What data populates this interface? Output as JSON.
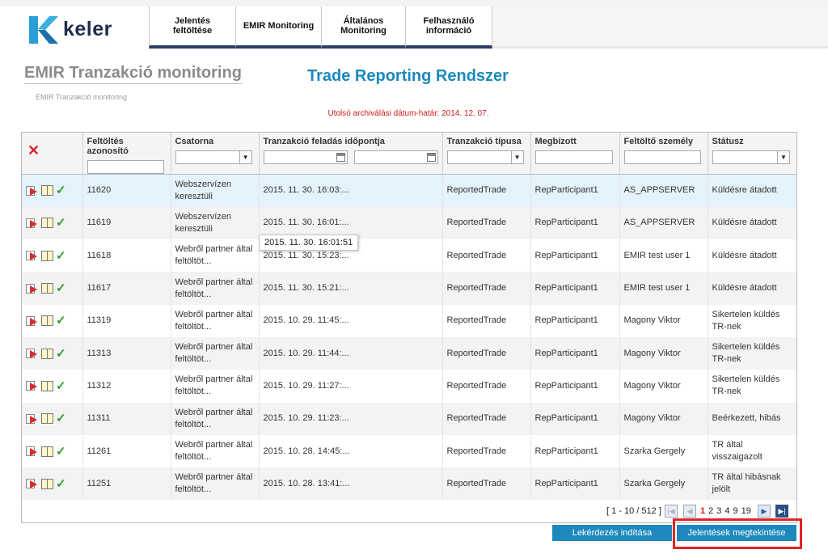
{
  "header": {
    "logo_text": "keler",
    "nav": [
      {
        "label": "Jelentés feltöltése"
      },
      {
        "label": "EMIR Monitoring"
      },
      {
        "label": "Általános Monitoring"
      },
      {
        "label": "Felhasználó információ"
      }
    ]
  },
  "page": {
    "title": "EMIR Tranzakció monitoring",
    "system_title": "Trade Reporting Rendszer",
    "breadcrumb": "EMIR Tranzakció monitoring",
    "archive_label": "Utolsó archiválási dátum-határ:",
    "archive_date": "2014. 12. 07."
  },
  "table": {
    "columns": [
      {
        "label": ""
      },
      {
        "label": "Feltöltés azonosító"
      },
      {
        "label": "Csatorna"
      },
      {
        "label": "Tranzakció feladás időpontja"
      },
      {
        "label": "Tranzakció típusa"
      },
      {
        "label": "Megbízott"
      },
      {
        "label": "Feltöltő személy"
      },
      {
        "label": "Státusz"
      }
    ],
    "rows": [
      {
        "id": "11620",
        "channel": "Webszervízen keresztüli",
        "time": "2015. 11. 30. 16:03:...",
        "type": "ReportedTrade",
        "agent": "RepParticipant1",
        "uploader": "AS_APPSERVER",
        "status": "Küldésre átadott"
      },
      {
        "id": "11619",
        "channel": "Webszervízen keresztüli",
        "time": "2015. 11. 30. 16:01:...",
        "type": "ReportedTrade",
        "agent": "RepParticipant1",
        "uploader": "AS_APPSERVER",
        "status": "Küldésre átadott"
      },
      {
        "id": "11618",
        "channel": "Webről partner által feltöltöt...",
        "time": "2015. 11. 30. 15:23:...",
        "type": "ReportedTrade",
        "agent": "RepParticipant1",
        "uploader": "EMIR test user 1",
        "status": "Küldésre átadott"
      },
      {
        "id": "11617",
        "channel": "Webről partner által feltöltöt...",
        "time": "2015. 11. 30. 15:21:...",
        "type": "ReportedTrade",
        "agent": "RepParticipant1",
        "uploader": "EMIR test user 1",
        "status": "Küldésre átadott"
      },
      {
        "id": "11319",
        "channel": "Webről partner által feltöltöt...",
        "time": "2015. 10. 29. 11:45:...",
        "type": "ReportedTrade",
        "agent": "RepParticipant1",
        "uploader": "Magony Viktor",
        "status": "Sikertelen küldés TR-nek"
      },
      {
        "id": "11313",
        "channel": "Webről partner által feltöltöt...",
        "time": "2015. 10. 29. 11:44:...",
        "type": "ReportedTrade",
        "agent": "RepParticipant1",
        "uploader": "Magony Viktor",
        "status": "Sikertelen küldés TR-nek"
      },
      {
        "id": "11312",
        "channel": "Webről partner által feltöltöt...",
        "time": "2015. 10. 29. 11:27:...",
        "type": "ReportedTrade",
        "agent": "RepParticipant1",
        "uploader": "Magony Viktor",
        "status": "Sikertelen küldés TR-nek"
      },
      {
        "id": "11311",
        "channel": "Webről partner által feltöltöt...",
        "time": "2015. 10. 29. 11:23:...",
        "type": "ReportedTrade",
        "agent": "RepParticipant1",
        "uploader": "Magony Viktor",
        "status": "Beérkezett, hibás"
      },
      {
        "id": "11261",
        "channel": "Webről partner által feltöltöt...",
        "time": "2015. 10. 28. 14:45:...",
        "type": "ReportedTrade",
        "agent": "RepParticipant1",
        "uploader": "Szarka Gergely",
        "status": "TR által visszaigazolt"
      },
      {
        "id": "11251",
        "channel": "Webről partner által feltöltöt...",
        "time": "2015. 10. 28. 13:41:...",
        "type": "ReportedTrade",
        "agent": "RepParticipant1",
        "uploader": "Szarka Gergely",
        "status": "TR által hibásnak jelölt"
      }
    ],
    "tooltip": "2015. 11. 30. 16:01:51"
  },
  "pager": {
    "range": "[ 1 - 10 / 512 ]",
    "pages": [
      "1",
      "2",
      "3",
      "4",
      "9",
      "19"
    ],
    "current": "1",
    "first_glyph": "|◀",
    "prev_glyph": "◀",
    "next_glyph": "▶",
    "last_glyph": "▶|"
  },
  "buttons": {
    "query": "Lekérdezés indítása",
    "reports": "Jelentések megtekintése"
  },
  "icons": {
    "clear_filters": "clear-filters-icon",
    "send": "send-icon",
    "view": "book-icon",
    "approve": "check-icon"
  },
  "colors": {
    "accent_blue": "#1c88bd",
    "nav_dark": "#2b3f66",
    "error_red": "#d11a1a",
    "highlight_red": "#e02424",
    "check_green": "#2e9e2e"
  }
}
